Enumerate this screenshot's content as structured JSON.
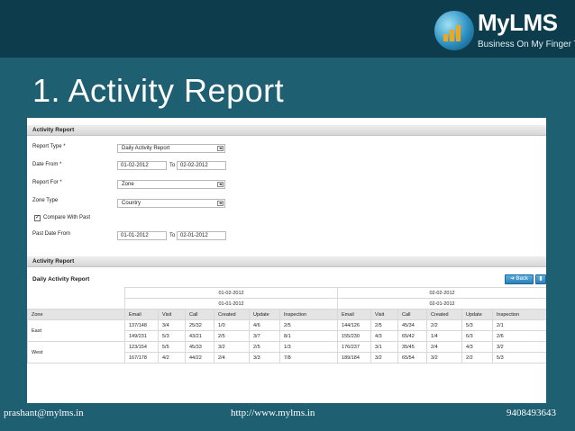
{
  "brand": {
    "name": "MyLMS",
    "tagline": "Business On My Finger Tip",
    "colors": {
      "header": "#0d3d4c",
      "background": "#1f5f72",
      "accent": "#f2a71b"
    }
  },
  "slide_title": "1. Activity Report",
  "form": {
    "header": "Activity Report",
    "report_type_label": "Report Type *",
    "report_type_value": "Daily Activity Report",
    "date_from_label": "Date From *",
    "date_from_value": "01-02-2012",
    "to_label": "To",
    "date_to_value": "02-02-2012",
    "report_for_label": "Report For *",
    "report_for_value": "Zone",
    "zone_type_label": "Zone Type",
    "zone_type_value": "Country",
    "compare_label": "Compare With Past",
    "compare_checked": true,
    "past_date_label": "Past Date From",
    "past_from_value": "01-01-2012",
    "past_to_value": "02-01-2012"
  },
  "report": {
    "header": "Activity Report",
    "subtitle": "Daily Activity Report",
    "back_label": "Back",
    "periods": [
      {
        "current": "01-02-2012",
        "past": "01-01-2012"
      },
      {
        "current": "02-02-2012",
        "past": "02-01-2012"
      }
    ],
    "zone_label": "Zone",
    "columns": [
      "Email",
      "Visit",
      "Call",
      "Created",
      "Update",
      "Inspection"
    ],
    "rows": [
      {
        "zone": "East",
        "p1": [
          "137/148",
          "3/4",
          "25/32",
          "1/0",
          "4/6",
          "2/5"
        ],
        "p2": [
          "144/126",
          "2/5",
          "45/34",
          "2/2",
          "5/3",
          "2/1"
        ]
      },
      {
        "zone": "",
        "p1": [
          "149/231",
          "5/3",
          "43/21",
          "2/5",
          "3/7",
          "8/1"
        ],
        "p2": [
          "155/230",
          "4/3",
          "65/42",
          "1/4",
          "6/3",
          "2/6"
        ]
      },
      {
        "zone": "West",
        "p1": [
          "123/154",
          "5/5",
          "45/33",
          "3/2",
          "2/5",
          "1/3"
        ],
        "p2": [
          "176/237",
          "3/1",
          "35/45",
          "2/4",
          "4/3",
          "3/2"
        ]
      },
      {
        "zone": "",
        "p1": [
          "167/178",
          "4/2",
          "44/22",
          "2/4",
          "3/3",
          "7/8"
        ],
        "p2": [
          "189/184",
          "3/2",
          "65/54",
          "3/2",
          "2/2",
          "5/3"
        ]
      }
    ]
  },
  "footer": {
    "email": "prashant@mylms.in",
    "url": "http://www.mylms.in",
    "phone": "9408493643"
  }
}
